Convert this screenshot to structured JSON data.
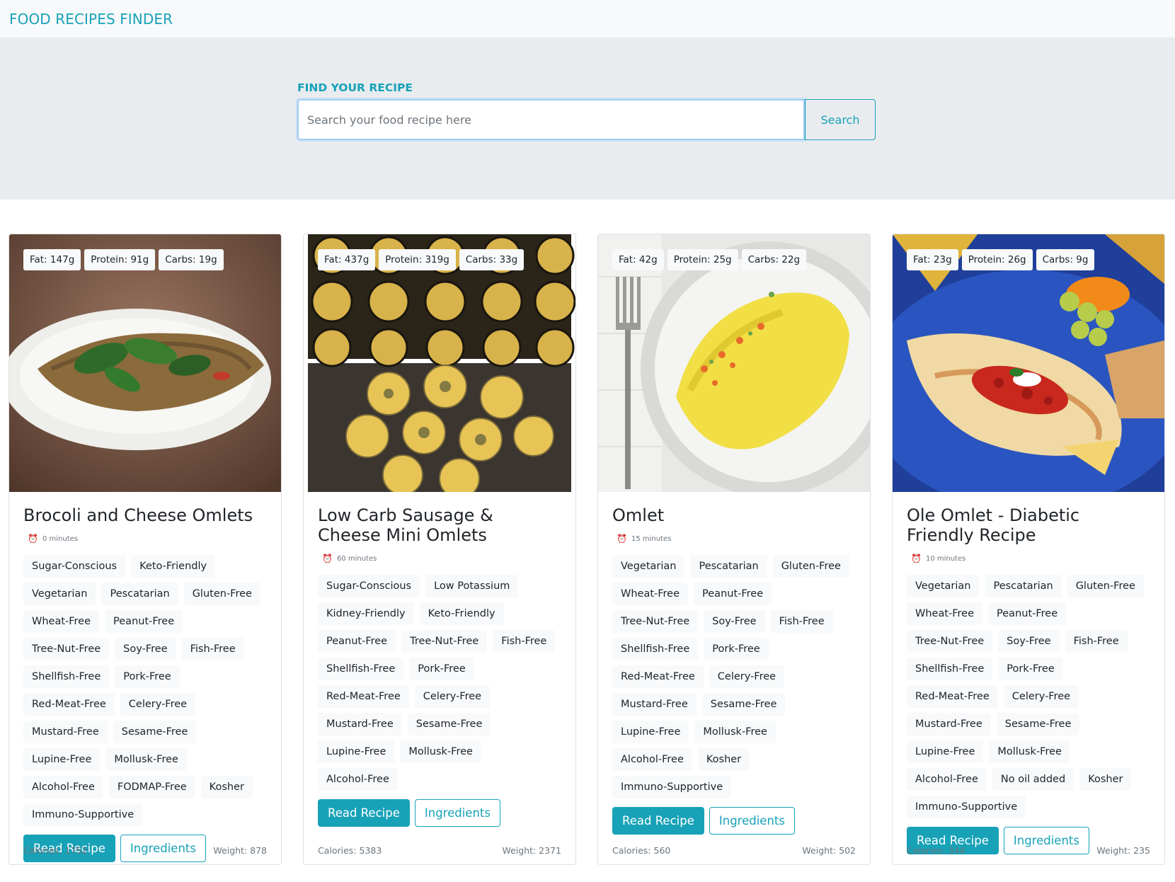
{
  "navbar": {
    "brand": "FOOD RECIPES FINDER"
  },
  "search": {
    "label": "FIND YOUR RECIPE",
    "placeholder": "Search your food recipe here",
    "button_label": "Search"
  },
  "cards": [
    {
      "fat": "Fat: 147g",
      "protein": "Protein: 91g",
      "carbs": "Carbs: 19g",
      "title": "Brocoli and Cheese Omlets",
      "time": "0 minutes",
      "labels": [
        "Sugar-Conscious",
        "Keto-Friendly",
        "Vegetarian",
        "Pescatarian",
        "Gluten-Free",
        "Wheat-Free",
        "Peanut-Free",
        "Tree-Nut-Free",
        "Soy-Free",
        "Fish-Free",
        "Shellfish-Free",
        "Pork-Free",
        "Red-Meat-Free",
        "Celery-Free",
        "Mustard-Free",
        "Sesame-Free",
        "Lupine-Free",
        "Mollusk-Free",
        "Alcohol-Free",
        "FODMAP-Free",
        "Kosher",
        "Immuno-Supportive"
      ],
      "read_label": "Read Recipe",
      "ingredients_label": "Ingredients",
      "calories": "Calories: 1752",
      "weight": "Weight: 878",
      "image": "omelet-spinach-plate"
    },
    {
      "fat": "Fat: 437g",
      "protein": "Protein: 319g",
      "carbs": "Carbs: 33g",
      "title": "Low Carb Sausage & Cheese Mini Omlets",
      "time": "60 minutes",
      "labels": [
        "Sugar-Conscious",
        "Low Potassium",
        "Kidney-Friendly",
        "Keto-Friendly",
        "Peanut-Free",
        "Tree-Nut-Free",
        "Fish-Free",
        "Shellfish-Free",
        "Pork-Free",
        "Red-Meat-Free",
        "Celery-Free",
        "Mustard-Free",
        "Sesame-Free",
        "Lupine-Free",
        "Mollusk-Free",
        "Alcohol-Free"
      ],
      "read_label": "Read Recipe",
      "ingredients_label": "Ingredients",
      "calories": "Calories: 5383",
      "weight": "Weight: 2371",
      "image": "mini-omelet-muffins"
    },
    {
      "fat": "Fat: 42g",
      "protein": "Protein: 25g",
      "carbs": "Carbs: 22g",
      "title": "Omlet",
      "time": "15 minutes",
      "labels": [
        "Vegetarian",
        "Pescatarian",
        "Gluten-Free",
        "Wheat-Free",
        "Peanut-Free",
        "Tree-Nut-Free",
        "Soy-Free",
        "Fish-Free",
        "Shellfish-Free",
        "Pork-Free",
        "Red-Meat-Free",
        "Celery-Free",
        "Mustard-Free",
        "Sesame-Free",
        "Lupine-Free",
        "Mollusk-Free",
        "Alcohol-Free",
        "Kosher",
        "Immuno-Supportive"
      ],
      "read_label": "Read Recipe",
      "ingredients_label": "Ingredients",
      "calories": "Calories: 560",
      "weight": "Weight: 502",
      "image": "omelet-white-plate-fork"
    },
    {
      "fat": "Fat: 23g",
      "protein": "Protein: 26g",
      "carbs": "Carbs: 9g",
      "title": "Ole Omlet - Diabetic Friendly Recipe",
      "time": "10 minutes",
      "labels": [
        "Vegetarian",
        "Pescatarian",
        "Gluten-Free",
        "Wheat-Free",
        "Peanut-Free",
        "Tree-Nut-Free",
        "Soy-Free",
        "Fish-Free",
        "Shellfish-Free",
        "Pork-Free",
        "Red-Meat-Free",
        "Celery-Free",
        "Mustard-Free",
        "Sesame-Free",
        "Lupine-Free",
        "Mollusk-Free",
        "Alcohol-Free",
        "No oil added",
        "Kosher",
        "Immuno-Supportive"
      ],
      "read_label": "Read Recipe",
      "ingredients_label": "Ingredients",
      "calories": "Calories: 344",
      "weight": "Weight: 235",
      "image": "omelet-salsa-blue-plate"
    }
  ],
  "colors": {
    "accent": "#17a2b8",
    "navbar_bg": "#f8f9fa",
    "hero_bg": "#e9ecef"
  }
}
